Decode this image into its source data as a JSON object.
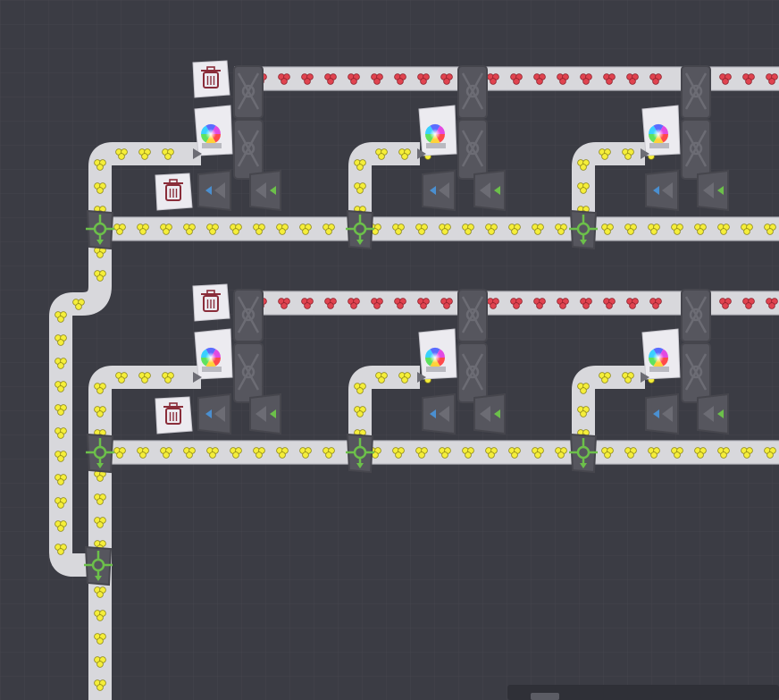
{
  "game": {
    "view": "factory-build-canvas",
    "colors": {
      "background": "#3b3c44",
      "grid_line": "#44454d",
      "belt": "#d8d8dc",
      "belt_edge": "#b9b9c0",
      "machine": "#56565e",
      "machine_dark": "#46464d",
      "machine_light": "#6c6c74",
      "item_red": "#e0434f",
      "item_yellow": "#f5ee3a",
      "arrow_green": "#6cc04a",
      "arrow_blue": "#4a8fd0",
      "trash_tile": "#ecebf0",
      "trash_icon": "#8a2d3a"
    },
    "item_types": [
      "red-shape",
      "yellow-shape"
    ],
    "module_rows": [
      {
        "row": "top",
        "modules": [
          {
            "column": 1,
            "trash_bins": 2,
            "painters": 1,
            "cutters": 2
          },
          {
            "column": 2,
            "trash_bins": 0,
            "painters": 1,
            "cutters": 2
          },
          {
            "column": 3,
            "trash_bins": 0,
            "painters": 1,
            "cutters": 2
          }
        ]
      },
      {
        "row": "bottom",
        "modules": [
          {
            "column": 1,
            "trash_bins": 2,
            "painters": 1,
            "cutters": 2
          },
          {
            "column": 2,
            "trash_bins": 0,
            "painters": 1,
            "cutters": 2
          },
          {
            "column": 3,
            "trash_bins": 0,
            "painters": 1,
            "cutters": 2
          }
        ]
      }
    ],
    "splitters": 6,
    "merge_junctions": 1,
    "icons": [
      "trash-icon",
      "color-wheel-icon",
      "splitter-icon",
      "cutter-icon",
      "arrow-left-icon",
      "arrow-down-icon"
    ]
  }
}
